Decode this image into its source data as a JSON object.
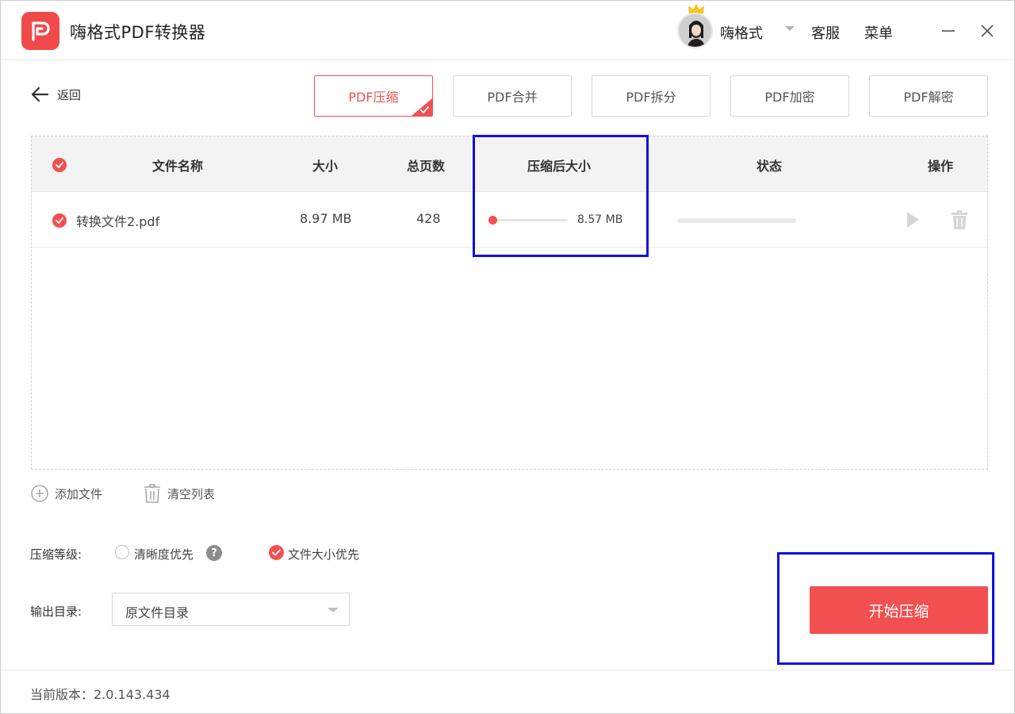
{
  "app": {
    "title": "嗨格式PDF转换器",
    "user_name": "嗨格式",
    "service_label": "客服",
    "menu_label": "菜单"
  },
  "toolbar": {
    "back_label": "返回",
    "tabs": [
      {
        "label": "PDF压缩",
        "active": true
      },
      {
        "label": "PDF合并",
        "active": false
      },
      {
        "label": "PDF拆分",
        "active": false
      },
      {
        "label": "PDF加密",
        "active": false
      },
      {
        "label": "PDF解密",
        "active": false
      }
    ]
  },
  "table": {
    "headers": {
      "name": "文件名称",
      "size": "大小",
      "pages": "总页数",
      "compressed_size": "压缩后大小",
      "status": "状态",
      "actions": "操作"
    },
    "rows": [
      {
        "name": "转换文件2.pdf",
        "size": "8.97 MB",
        "pages": "428",
        "compressed_size": "8.57 MB",
        "compression_slider": 0.03,
        "status_progress": 0
      }
    ]
  },
  "file_actions": {
    "add_file": "添加文件",
    "clear_list": "清空列表"
  },
  "settings": {
    "compression_level_label": "压缩等级:",
    "option_quality": "清晰度优先",
    "option_size": "文件大小优先",
    "selected_option": "文件大小优先",
    "output_dir_label": "输出目录:",
    "output_dir_value": "原文件目录"
  },
  "start_button": "开始压缩",
  "footer": {
    "version": "当前版本：2.0.143.434"
  },
  "colors": {
    "accent": "#f25050",
    "highlight": "#1010e0"
  }
}
